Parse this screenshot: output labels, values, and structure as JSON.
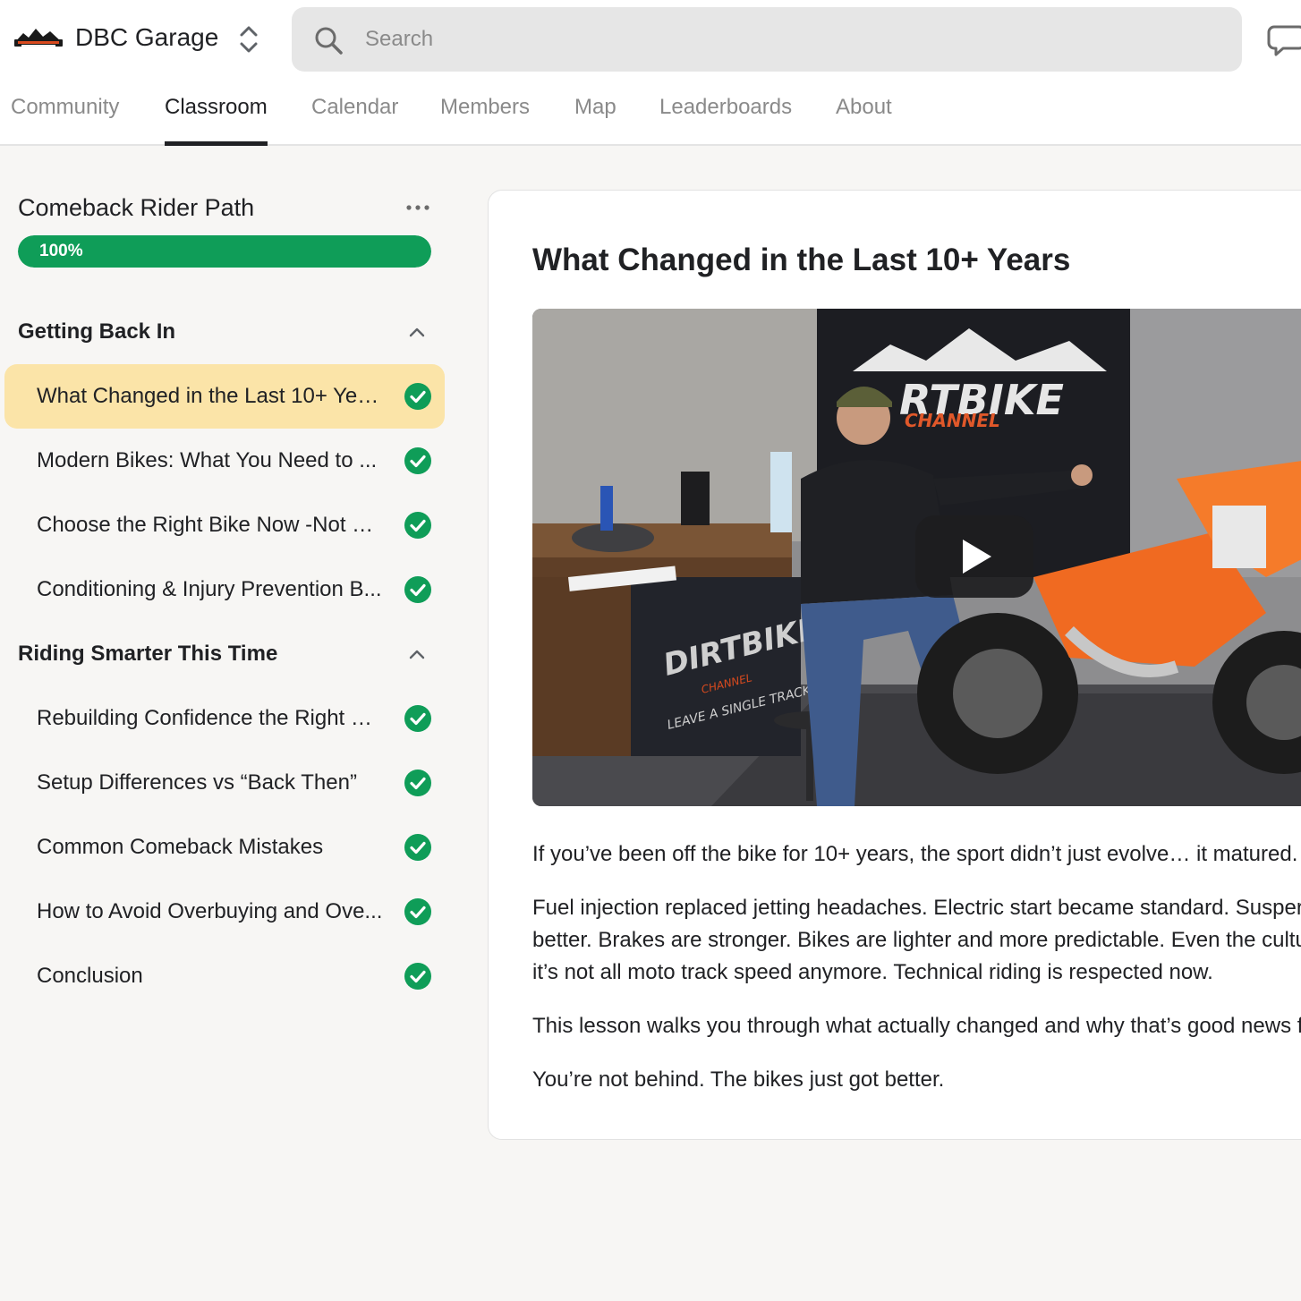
{
  "brand": {
    "name": "DBC Garage",
    "logo": "dirtbike-channel-logo"
  },
  "search": {
    "placeholder": "Search"
  },
  "nav": {
    "tabs": [
      {
        "label": "Community",
        "active": false
      },
      {
        "label": "Classroom",
        "active": true
      },
      {
        "label": "Calendar",
        "active": false
      },
      {
        "label": "Members",
        "active": false
      },
      {
        "label": "Map",
        "active": false
      },
      {
        "label": "Leaderboards",
        "active": false
      },
      {
        "label": "About",
        "active": false
      }
    ]
  },
  "course": {
    "title": "Comeback Rider Path",
    "progress": {
      "percent": 100,
      "label": "100%"
    }
  },
  "sections": [
    {
      "title": "Getting Back In",
      "expanded": true,
      "lessons": [
        {
          "label": "What Changed in the Last 10+ Yea...",
          "completed": true,
          "active": true
        },
        {
          "label": "Modern Bikes: What You Need to ...",
          "completed": true,
          "active": false
        },
        {
          "label": "Choose the Right Bike Now -Not W...",
          "completed": true,
          "active": false
        },
        {
          "label": "Conditioning & Injury Prevention B...",
          "completed": true,
          "active": false
        }
      ]
    },
    {
      "title": "Riding Smarter This Time",
      "expanded": true,
      "lessons": [
        {
          "label": "Rebuilding Confidence the Right W...",
          "completed": true,
          "active": false
        },
        {
          "label": "Setup Differences vs “Back Then”",
          "completed": true,
          "active": false
        },
        {
          "label": "Common Comeback Mistakes",
          "completed": true,
          "active": false
        },
        {
          "label": "How to Avoid Overbuying and Ove...",
          "completed": true,
          "active": false
        },
        {
          "label": "Conclusion",
          "completed": true,
          "active": false
        }
      ]
    }
  ],
  "lesson": {
    "title": "What Changed in the Last 10+ Years",
    "video": {
      "thumbnail": "rider-seated-by-orange-dirt-bike",
      "banner_text": "RTBIKE",
      "banner_subtext": "CHANNEL",
      "desk_banner_text": "DIRTBIKE",
      "desk_banner_subtext": "CHANNEL",
      "desk_banner_tagline": "LEAVE A SINGLE TRACK"
    },
    "paragraphs": [
      "If you’ve been off the bike for 10+ years, the sport didn’t just evolve… it matured.",
      "Fuel injection replaced jetting headaches. Electric start became standard. Susper\nbetter. Brakes are stronger. Bikes are lighter and more predictable. Even the cultu\nit’s not all moto track speed anymore. Technical riding is respected now.",
      "This lesson walks you through what actually changed and why that’s good news f",
      "You’re not behind. The bikes just got better."
    ]
  },
  "colors": {
    "accent_green": "#0f9d58",
    "active_lesson_bg": "#fbe4a8",
    "page_bg": "#f7f6f4"
  },
  "icons": [
    "search-icon",
    "chat-icon",
    "more-icon",
    "chevron-up-icon",
    "check-circle-icon",
    "play-icon",
    "switcher-icon"
  ]
}
